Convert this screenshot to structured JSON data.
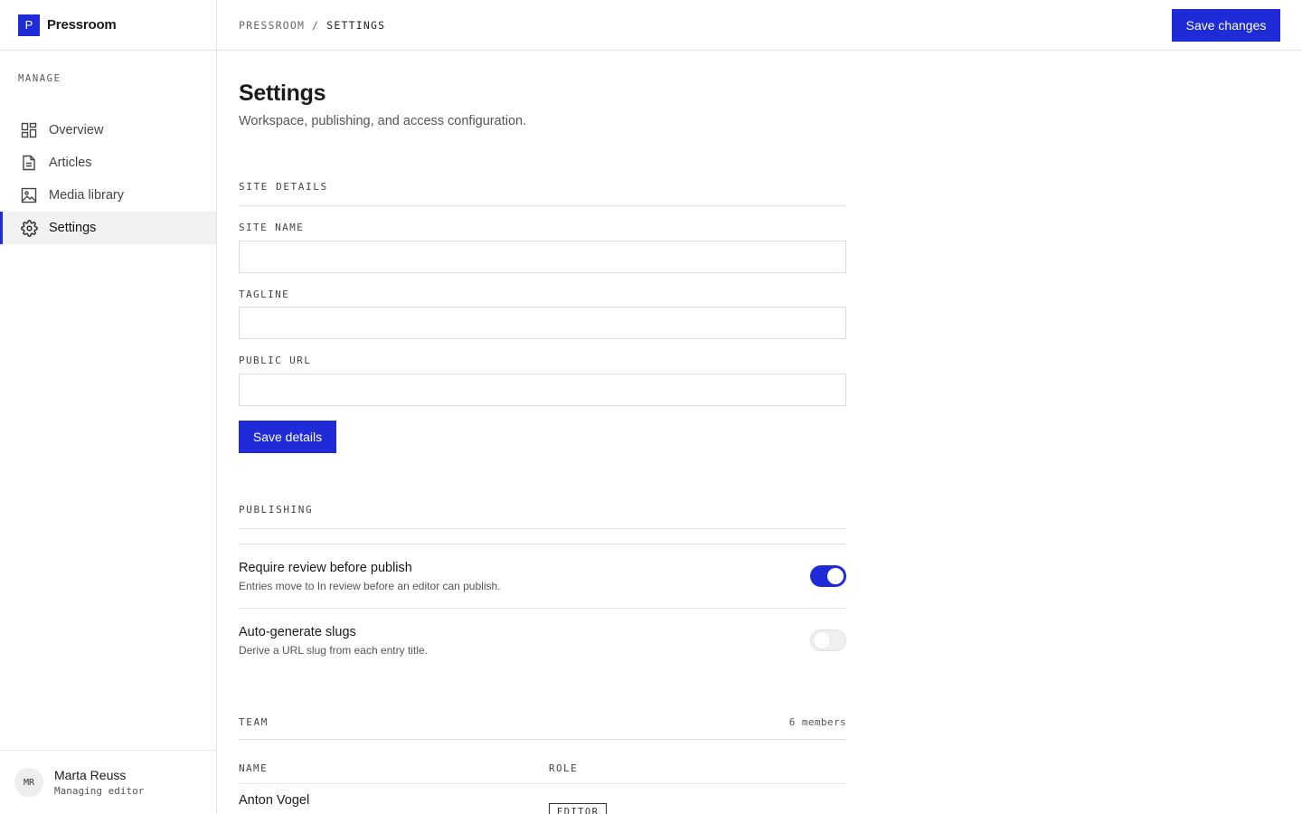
{
  "brand": {
    "mark": "P",
    "name": "Pressroom"
  },
  "sidebar": {
    "section": "MANAGE",
    "items": [
      {
        "label": "Overview",
        "icon": "grid-icon"
      },
      {
        "label": "Articles",
        "icon": "document-icon"
      },
      {
        "label": "Media library",
        "icon": "image-icon"
      },
      {
        "label": "Settings",
        "icon": "gear-icon",
        "active": true
      }
    ]
  },
  "user": {
    "initials": "MR",
    "name": "Marta Reuss",
    "role": "Managing editor"
  },
  "header": {
    "breadcrumb": {
      "parent": "PRESSROOM",
      "separator": "/",
      "current": "SETTINGS"
    },
    "save_label": "Save changes"
  },
  "page": {
    "title": "Settings",
    "subtitle": "Workspace, publishing, and access configuration."
  },
  "site_details": {
    "heading": "SITE DETAILS",
    "fields": [
      {
        "label": "SITE NAME",
        "value": "",
        "placeholder": ""
      },
      {
        "label": "TAGLINE",
        "value": "",
        "placeholder": ""
      },
      {
        "label": "PUBLIC URL",
        "value": "",
        "placeholder": ""
      }
    ],
    "save_label": "Save details"
  },
  "publishing": {
    "heading": "PUBLISHING",
    "toggles": [
      {
        "title": "Require review before publish",
        "description": "Entries move to In review before an editor can publish.",
        "on": true
      },
      {
        "title": "Auto-generate slugs",
        "description": "Derive a URL slug from each entry title.",
        "on": false
      }
    ]
  },
  "team": {
    "heading": "TEAM",
    "count": "6 members",
    "columns": [
      "NAME",
      "ROLE"
    ],
    "rows": [
      {
        "name": "Anton Vogel",
        "role": "EDITOR"
      }
    ]
  },
  "colors": {
    "accent": "#1f2bd6",
    "border": "#e4e4e4",
    "muted": "#555555"
  }
}
